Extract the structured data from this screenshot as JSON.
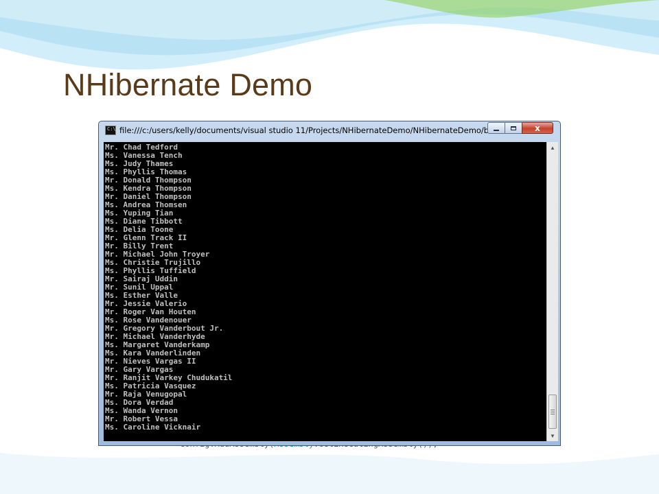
{
  "slide": {
    "title": "NHibernate Demo"
  },
  "background_code": {
    "line_start": "config.AddAssembly(",
    "line_keyword": "Assembly",
    "line_end": ".GetExecutingAssembly());"
  },
  "window": {
    "icon_label": "C:\\",
    "title": "file:///c:/users/kelly/documents/visual studio 11/Projects/NHibernateDemo/NHibernateDemo/bin/...",
    "minimize_icon": "minimize-icon",
    "maximize_icon": "maximize-icon",
    "close_label": "x"
  },
  "console": {
    "lines": [
      "Mr. Chad Tedford",
      "Ms. Vanessa Tench",
      "Ms. Judy Thames",
      "Ms. Phyllis Thomas",
      "Mr. Donald Thompson",
      "Ms. Kendra Thompson",
      "Mr. Daniel Thompson",
      "Ms. Andrea Thomsen",
      "Ms. Yuping Tian",
      "Ms. Diane Tibbott",
      "Ms. Delia Toone",
      "Mr. Glenn Track II",
      "Mr. Billy Trent",
      "Mr. Michael John Troyer",
      "Ms. Christie Trujillo",
      "Ms. Phyllis Tuffield",
      "Mr. Sairaj Uddin",
      "Mr. Sunil Uppal",
      "Ms. Esther Valle",
      "Mr. Jessie Valerio",
      "Mr. Roger Van Houten",
      "Ms. Rose Vandenouer",
      "Mr. Gregory Vanderbout Jr.",
      "Mr. Michael Vanderhyde",
      "Ms. Margaret Vanderkamp",
      "Ms. Kara Vanderlinden",
      "Mr. Nieves Vargas II",
      "Mr. Gary Vargas",
      "Mr. Ranjit Varkey Chudukatil",
      "Ms. Patricia Vasquez",
      "Mr. Raja Venugopal",
      "Ms. Dora Verdad",
      "Ms. Wanda Vernon",
      "Mr. Robert Vessa",
      "Ms. Caroline Vicknair"
    ]
  },
  "colors": {
    "title": "#5a3a18",
    "console_bg": "#000000",
    "console_text": "#c0c0c0",
    "wave_blue": "#bfe3f2",
    "wave_green": "#7cc142"
  }
}
